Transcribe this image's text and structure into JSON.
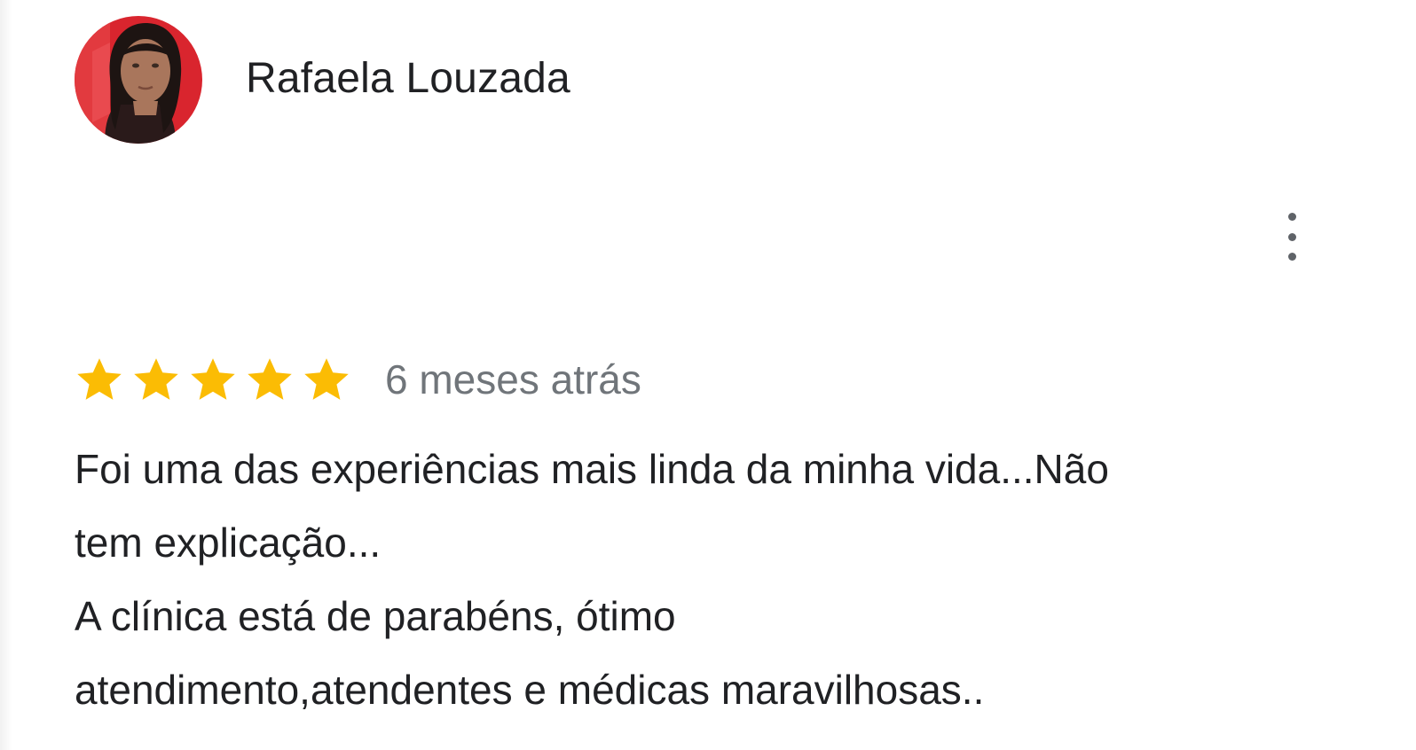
{
  "review": {
    "author_name": "Rafaela Louzada",
    "rating": 5,
    "rating_max": 5,
    "date": "6 meses atrás",
    "text_lines": [
      "Foi uma das experiências mais linda da minha vida...Não",
      "tem explicação...",
      "A clínica está de parabéns, ótimo",
      "atendimento,atendentes e médicas maravilhosas.."
    ]
  },
  "icons": {
    "more": "more-vert-icon",
    "star": "star-icon"
  },
  "colors": {
    "star": "#fbbc04",
    "name_text": "#202124",
    "date_text": "#70757a",
    "body_text": "#202124",
    "menu_dots": "#5f6368",
    "avatar_bg": "#d9252e"
  }
}
